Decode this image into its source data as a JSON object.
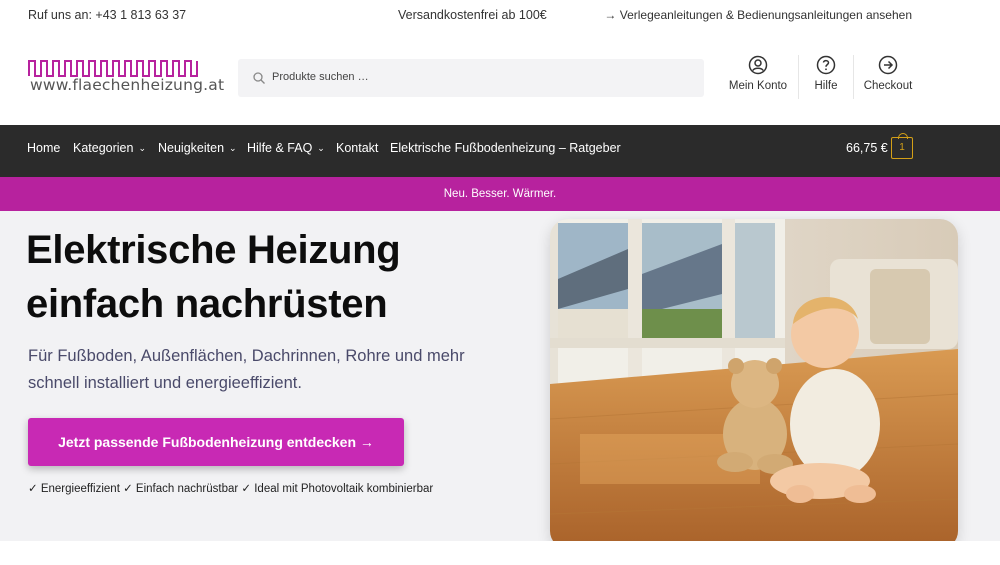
{
  "topbar": {
    "phone": "Ruf uns an: +43 1 813 63 37",
    "shipping": "Versandkostenfrei ab 100€",
    "guides_link": "→ Verlegeanleitungen & Bedienungsanleitungen ansehen"
  },
  "header": {
    "logo_text": "www.flaechenheizung.at",
    "search_placeholder": "Produkte suchen …",
    "account_label": "Mein Konto",
    "help_label": "Hilfe",
    "checkout_label": "Checkout"
  },
  "nav": {
    "items": [
      {
        "label": "Home",
        "has_dropdown": false
      },
      {
        "label": "Kategorien",
        "has_dropdown": true
      },
      {
        "label": "Neuigkeiten",
        "has_dropdown": true
      },
      {
        "label": "Hilfe & FAQ",
        "has_dropdown": true
      },
      {
        "label": "Kontakt",
        "has_dropdown": false
      },
      {
        "label": "Elektrische Fußbodenheizung – Ratgeber",
        "has_dropdown": false
      }
    ],
    "cart_total": "66,75 €",
    "cart_count": "1"
  },
  "promo": {
    "text": "Neu. Besser. Wärmer."
  },
  "hero": {
    "title_line1": "Elektrische Heizung",
    "title_line2": "einfach nachrüsten",
    "lead": "Für Fußboden, Außenflächen, Dachrinnen, Rohre und mehr schnell installiert und energieeffizient.",
    "cta_label": "Jetzt passende Fußbodenheizung entdecken →",
    "features": "✓ Energieeffizient ✓ Einfach nachrüstbar ✓ Ideal mit Photovoltaik kombinierbar"
  },
  "colors": {
    "brand_magenta": "#c829b4",
    "promo_bar": "#b7229e",
    "navbar": "#2b2b2b",
    "cart_accent": "#d4a017"
  },
  "icons": {
    "search": "search-icon",
    "account": "user-circle-icon",
    "help": "question-circle-icon",
    "checkout": "arrow-circle-right-icon",
    "cart": "shopping-bag-icon"
  }
}
